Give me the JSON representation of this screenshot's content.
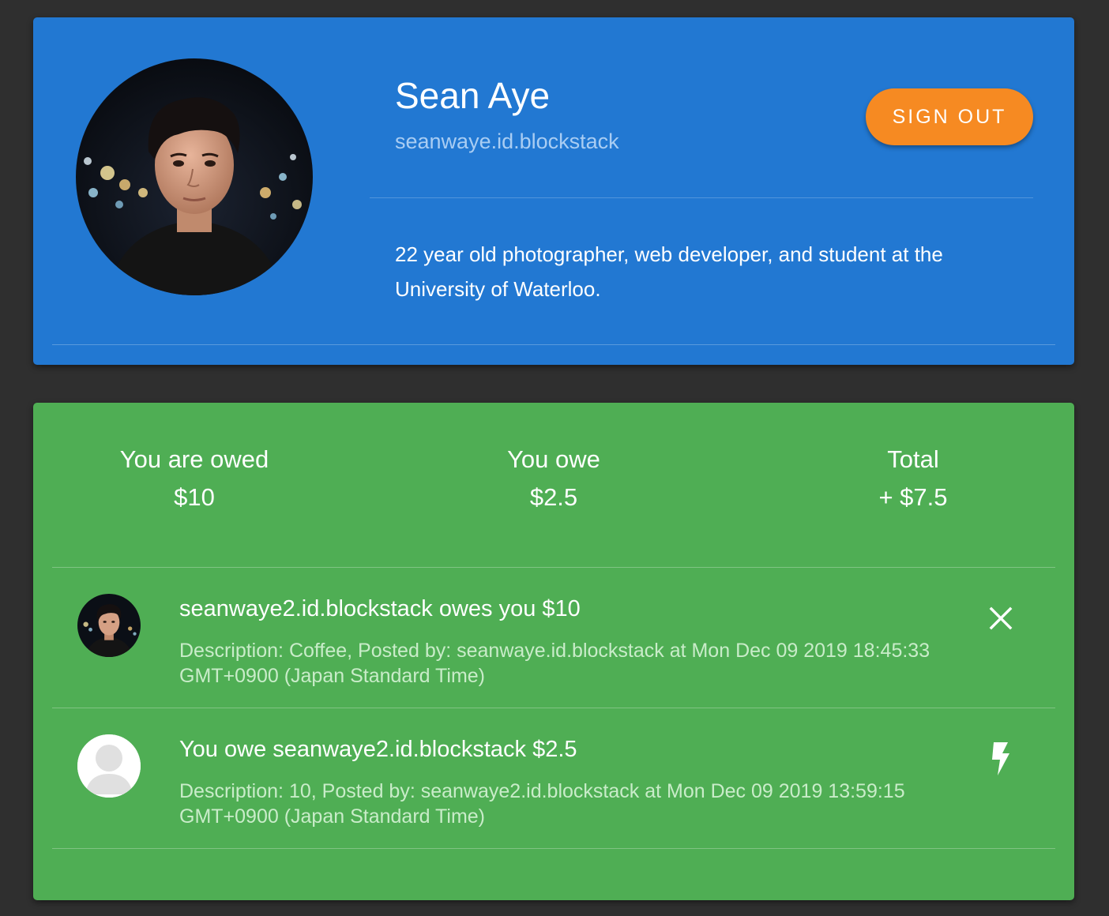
{
  "profile": {
    "name": "Sean Aye",
    "username": "seanwaye.id.blockstack",
    "bio": "22 year old photographer, web developer, and student at the University of Waterloo.",
    "sign_out_label": "SIGN OUT",
    "card_color": "#2278d2",
    "button_color": "#f68a22"
  },
  "summary": {
    "owed_label": "You are owed",
    "owed_value": "$10",
    "owe_label": "You owe",
    "owe_value": "$2.5",
    "total_label": "Total",
    "total_value": "+ $7.5",
    "card_color": "#4fae54"
  },
  "transactions": [
    {
      "avatar": "profile-photo",
      "title": "seanwaye2.id.blockstack owes you $10",
      "description": "Description: Coffee, Posted by: seanwaye.id.blockstack at Mon Dec 09 2019 18:45:33 GMT+0900 (Japan Standard Time)",
      "action_icon": "close-icon"
    },
    {
      "avatar": "default-user-avatar",
      "title": "You owe seanwaye2.id.blockstack $2.5",
      "description": "Description: 10, Posted by: seanwaye2.id.blockstack at Mon Dec 09 2019 13:59:15 GMT+0900 (Japan Standard Time)",
      "action_icon": "lightning-bolt-icon"
    }
  ]
}
